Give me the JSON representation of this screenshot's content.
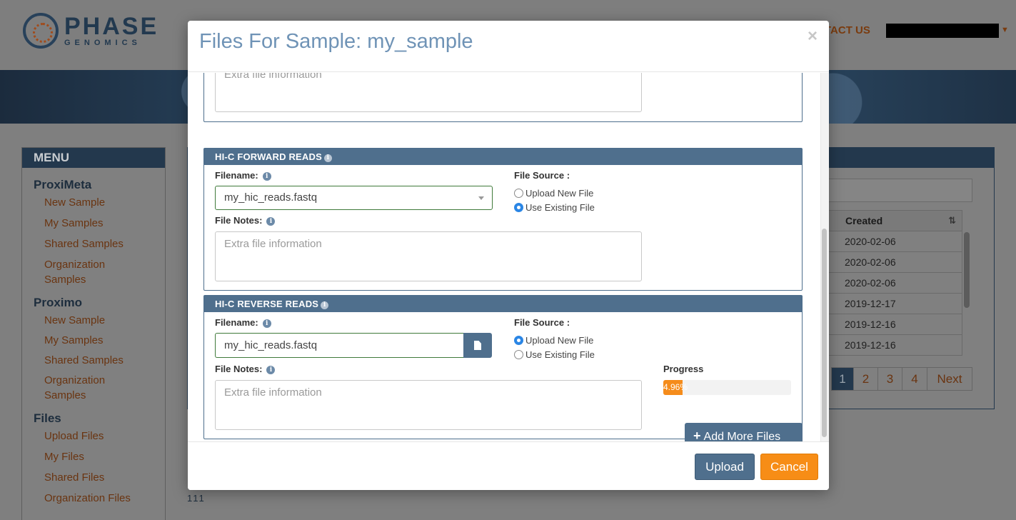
{
  "page": {
    "brand": {
      "title": "PHASE",
      "subtitle": "GENOMICS"
    },
    "contact": "TACT US",
    "menu": {
      "title": "MENU",
      "sections": [
        {
          "title": "ProxiMeta",
          "items": [
            "New Sample",
            "My Samples",
            "Shared Samples",
            "Organization Samples"
          ]
        },
        {
          "title": "Proximo",
          "items": [
            "New Sample",
            "My Samples",
            "Shared Samples",
            "Organization Samples"
          ]
        },
        {
          "title": "Files",
          "items": [
            "Upload Files",
            "My Files",
            "Shared Files",
            "Organization Files"
          ]
        }
      ]
    },
    "table": {
      "column": "Created",
      "rows": [
        "2020-02-06",
        "2020-02-06",
        "2020-02-06",
        "2019-12-17",
        "2019-12-16",
        "2019-12-16"
      ]
    },
    "pagination": [
      "1",
      "2",
      "3",
      "4",
      "Next"
    ],
    "footer_dots": "111"
  },
  "modal": {
    "title": "Files For Sample: my_sample",
    "close": "×",
    "top_block": {
      "notes_placeholder": "Extra file information"
    },
    "forward": {
      "header": "HI-C FORWARD READS",
      "filename_label": "Filename:",
      "filename_value": "my_hic_reads.fastq",
      "source_label": "File Source :",
      "source_options": [
        "Upload New File",
        "Use Existing File"
      ],
      "source_selected": "Use Existing File",
      "notes_label": "File Notes:",
      "notes_placeholder": "Extra file information"
    },
    "reverse": {
      "header": "HI-C REVERSE READS",
      "filename_label": "Filename:",
      "filename_value": "my_hic_reads.fastq",
      "source_label": "File Source :",
      "source_options": [
        "Upload New File",
        "Use Existing File"
      ],
      "source_selected": "Upload New File",
      "notes_label": "File Notes:",
      "notes_placeholder": "Extra file information",
      "progress_label": "Progress",
      "progress_text": "4.96%",
      "progress_percent": 4.96
    },
    "add_more": "Add More Files",
    "buttons": {
      "upload": "Upload",
      "cancel": "Cancel"
    }
  },
  "colors": {
    "header_blue": "#4f6f8d",
    "accent_orange": "#f78d16",
    "title_blue": "#6f93b6"
  }
}
